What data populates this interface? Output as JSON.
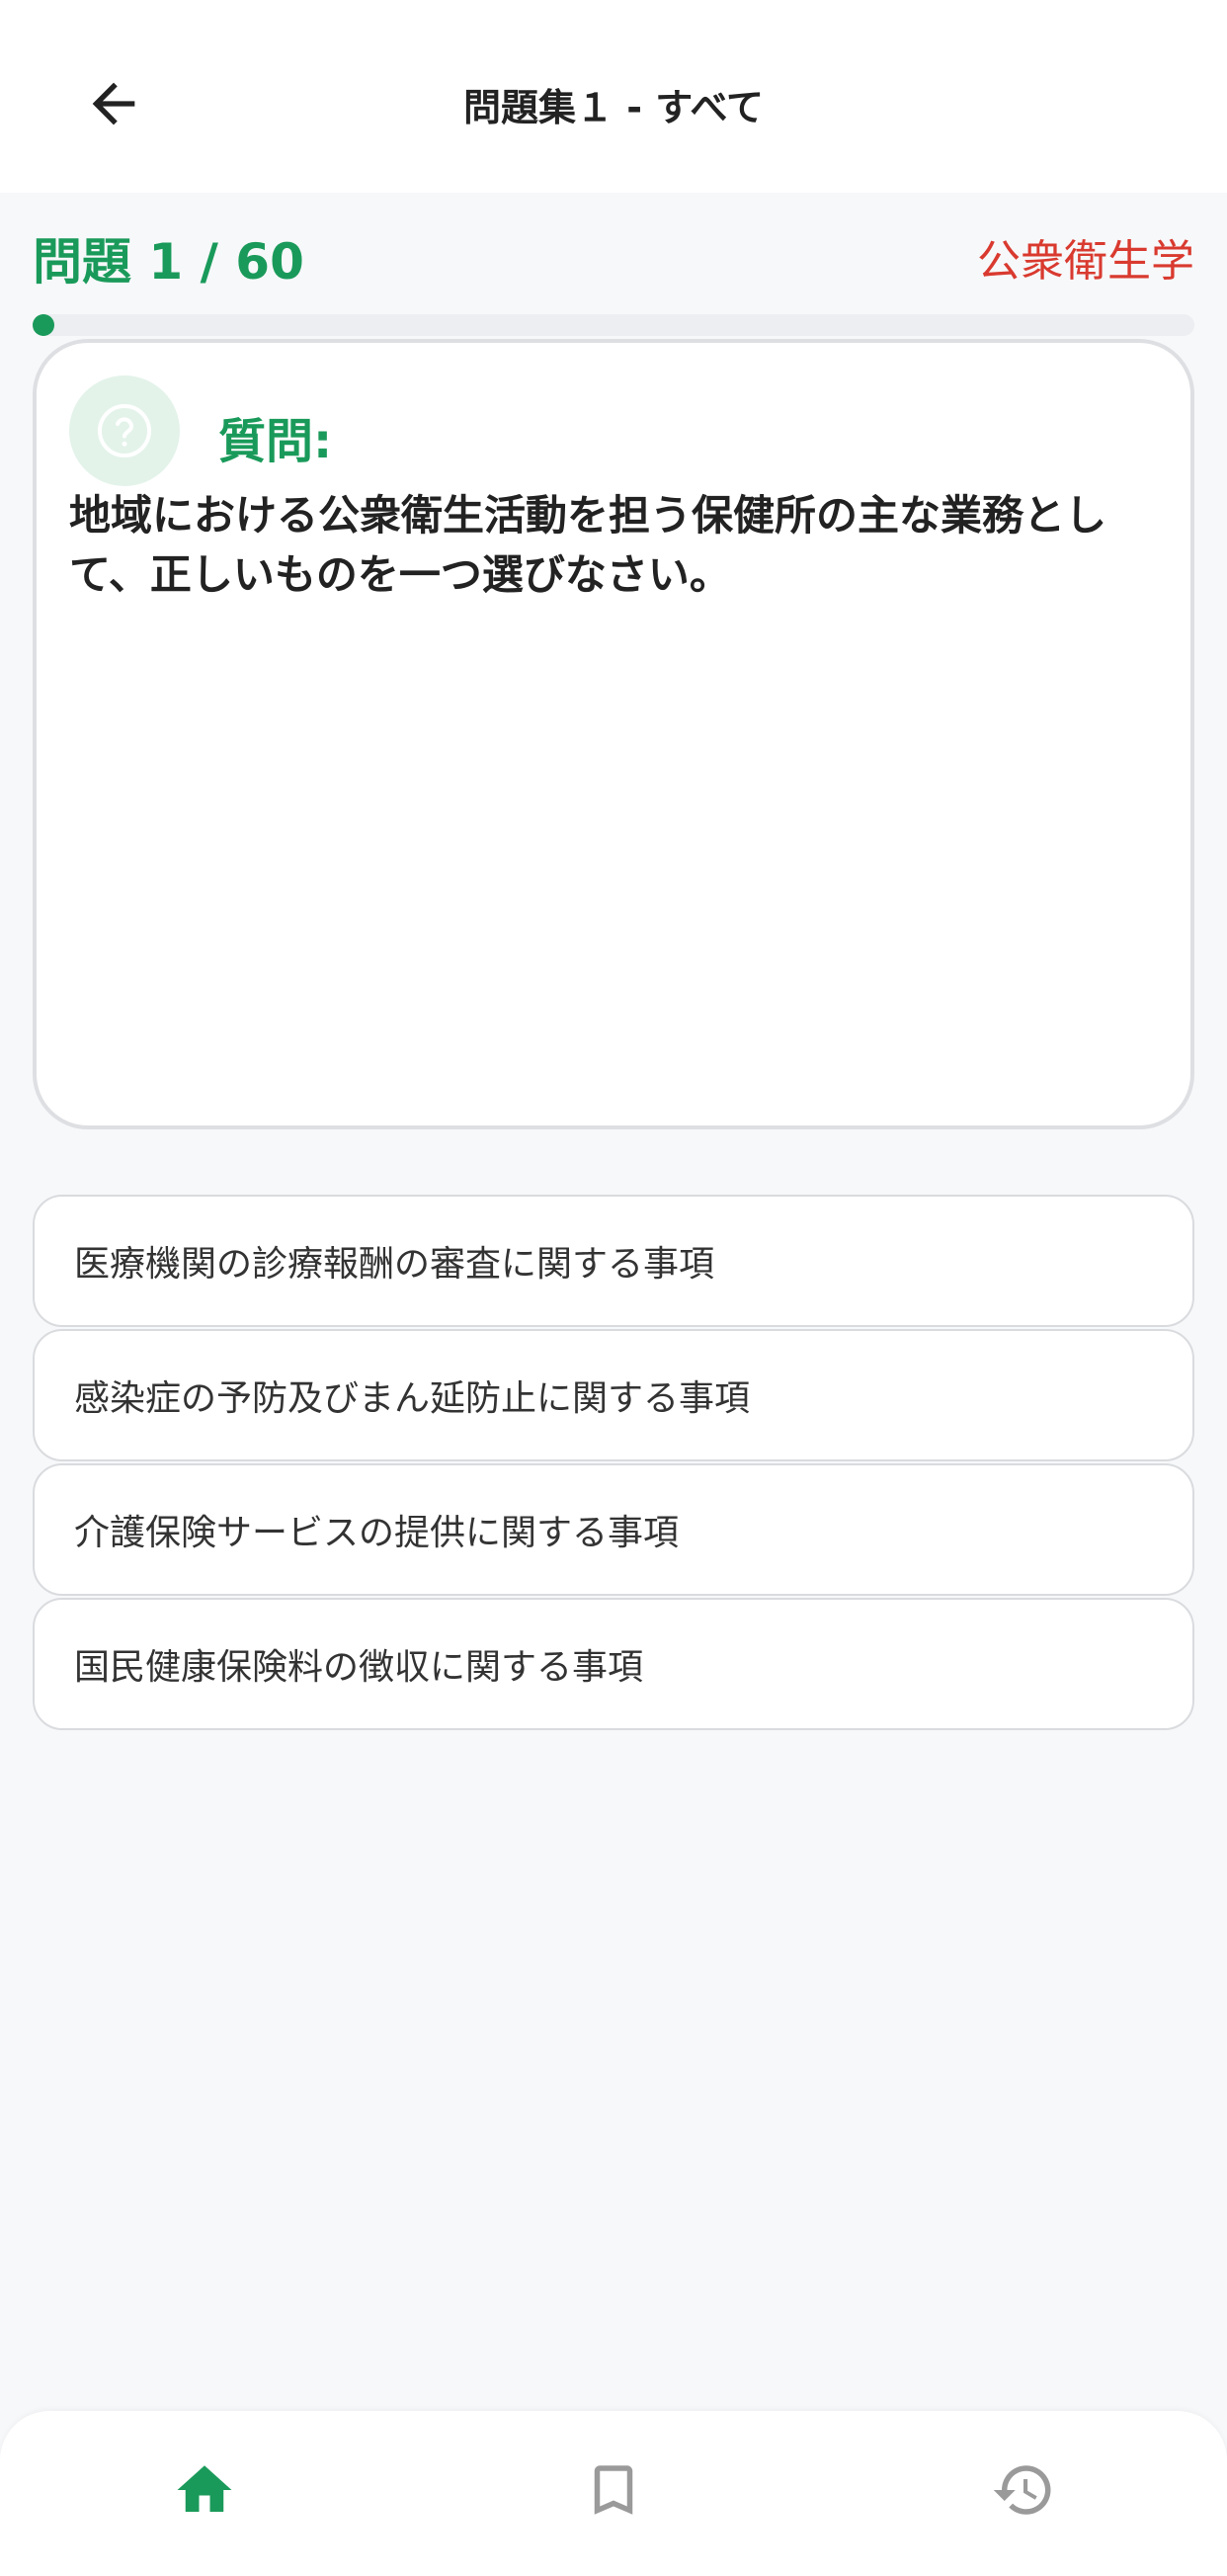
{
  "header": {
    "title": "問題集１ - すべて",
    "back_icon": "arrow-left-icon"
  },
  "progress": {
    "counter": "問題 1 / 60",
    "current": 1,
    "total": 60,
    "category": "公衆衛生学"
  },
  "question": {
    "label": "質問:",
    "icon": "question-circle-icon",
    "text": "地域における公衆衛生活動を担う保健所の主な業務として、正しいものを一つ選びなさい。"
  },
  "options": [
    {
      "label": "医療機関の診療報酬の審査に関する事項"
    },
    {
      "label": "感染症の予防及びまん延防止に関する事項"
    },
    {
      "label": "介護保険サービスの提供に関する事項"
    },
    {
      "label": "国民健康保険料の徴収に関する事項"
    }
  ],
  "nav": {
    "items": [
      {
        "icon": "home-icon",
        "active": true
      },
      {
        "icon": "bookmark-icon",
        "active": false
      },
      {
        "icon": "history-icon",
        "active": false
      }
    ]
  },
  "colors": {
    "accent": "#1a9a5a",
    "category": "#d93a2f",
    "inactive_icon": "#9a9a9a"
  }
}
